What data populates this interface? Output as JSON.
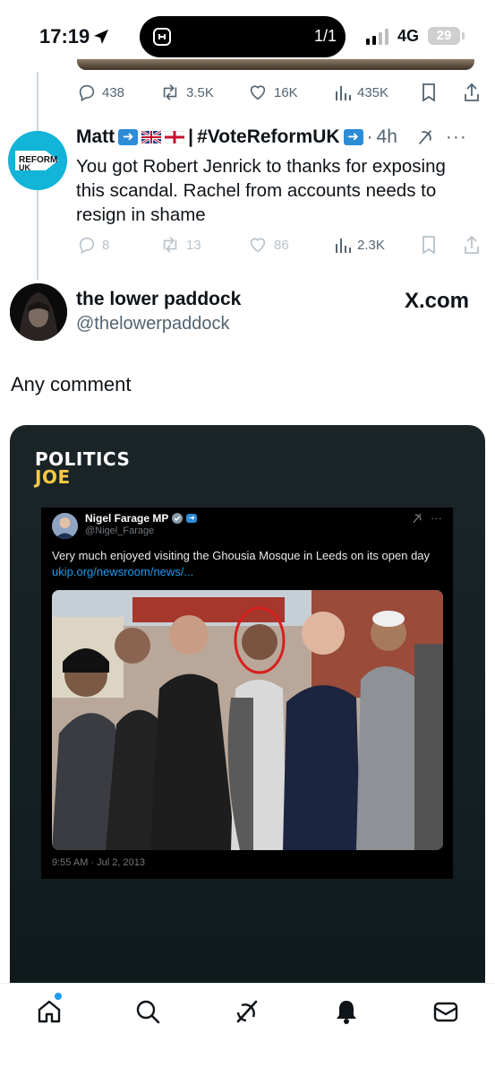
{
  "status_bar": {
    "time": "17:19",
    "window_counter": "1/1",
    "network": "4G",
    "battery": "29"
  },
  "prev_tweet_actions": {
    "replies": "438",
    "reposts": "3.5K",
    "likes": "16K",
    "views": "435K"
  },
  "reply": {
    "avatar_logo_top": "REFORM",
    "avatar_logo_bottom": "UK",
    "name": "Matt",
    "name_suffix": "#VoteReformUK",
    "separator": "|",
    "time": "4h",
    "text": "You got Robert Jenrick to thanks for exposing this scandal. Rachel from accounts needs to resign in shame",
    "actions": {
      "replies": "8",
      "reposts": "13",
      "likes": "86",
      "views": "2.3K"
    }
  },
  "post": {
    "name": "the lower paddock",
    "handle": "@thelowerpaddock",
    "source": "X.com",
    "text": "Any comment",
    "embed": {
      "brand_top": "POLITICS",
      "brand_bottom": "JOE",
      "tweet": {
        "name": "Nigel Farage MP",
        "handle": "@Nigel_Farage",
        "text": "Very much enjoyed visiting the Ghousia Mosque in Leeds on its open day",
        "link": "ukip.org/newsroom/news/...",
        "date": "9:55 AM · Jul 2, 2013"
      }
    }
  },
  "icons": {
    "nav": [
      "home-icon",
      "search-icon",
      "grok-icon",
      "notifications-icon",
      "messages-icon"
    ]
  },
  "colors": {
    "accent": "#1d9bf0",
    "reform_teal": "#12b5d7",
    "politics_joe_yellow": "#f6c945",
    "highlight_ring": "#d61f1f"
  }
}
